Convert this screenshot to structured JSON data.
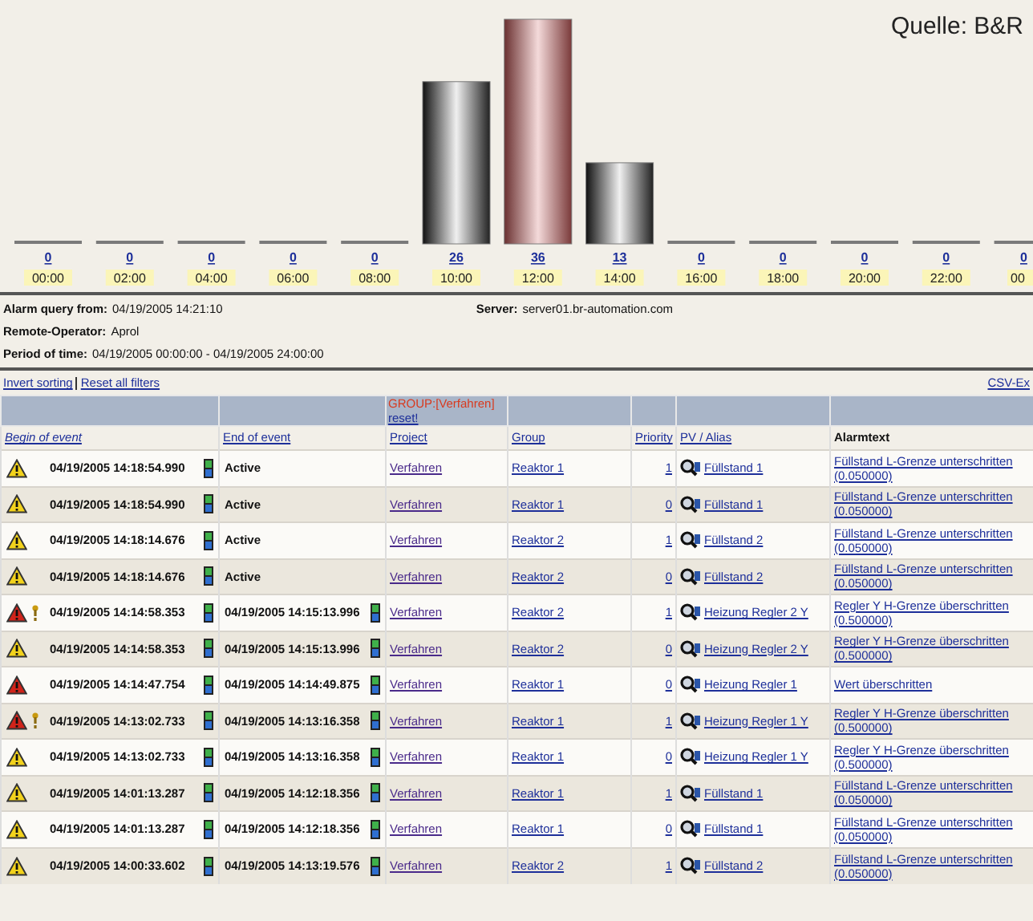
{
  "source_credit": "Quelle: B&R",
  "chart": {
    "chart_data": {
      "type": "bar",
      "categories": [
        "00:00",
        "02:00",
        "04:00",
        "06:00",
        "08:00",
        "10:00",
        "12:00",
        "14:00",
        "16:00",
        "18:00",
        "20:00",
        "22:00",
        "00"
      ],
      "series": [
        {
          "color": "#7a7a7a",
          "values": [
            0,
            0,
            0,
            0,
            0,
            26,
            36,
            13,
            0,
            0,
            0,
            0,
            0
          ]
        }
      ],
      "data_labels": true
    }
  },
  "query_info": [
    {
      "label": "Alarm query from:",
      "value": "04/19/2005 14:21:10"
    },
    {
      "label": "Remote-Operator:",
      "value": "Aprol"
    },
    {
      "label": "Period of time:",
      "value": "04/19/2005 00:00:00 - 04/19/2005 24:00:00"
    }
  ],
  "server": {
    "label": "Server:",
    "value": "server01.br-automation.com"
  },
  "links": [
    "Invert sorting",
    "Reset all filters"
  ],
  "csv_link": "CSV-Ex",
  "group_filter": {
    "text": "GROUP:[Verfahren]",
    "reset": "reset!"
  },
  "columns": [
    "Begin of event",
    "End of event",
    "Project",
    "Group",
    "Priority",
    "PV / Alias",
    "Alarmtext"
  ],
  "rows": [
    {
      "kind": "warning",
      "flag": false,
      "begin": "04/19/2005 14:18:54.990",
      "end": "Active",
      "end_active": true,
      "project": "Verfahren",
      "group": "Reaktor 1",
      "priority": "1",
      "pv": "Füllstand 1",
      "alarmtext": "Füllstand L-Grenze unterschritten (0.050000)"
    },
    {
      "kind": "warning",
      "flag": false,
      "begin": "04/19/2005 14:18:54.990",
      "end": "Active",
      "end_active": true,
      "project": "Verfahren",
      "group": "Reaktor 1",
      "priority": "0",
      "pv": "Füllstand 1",
      "alarmtext": "Füllstand L-Grenze unterschritten (0.050000)"
    },
    {
      "kind": "warning",
      "flag": false,
      "begin": "04/19/2005 14:18:14.676",
      "end": "Active",
      "end_active": true,
      "project": "Verfahren",
      "group": "Reaktor 2",
      "priority": "1",
      "pv": "Füllstand 2",
      "alarmtext": "Füllstand L-Grenze unterschritten (0.050000)"
    },
    {
      "kind": "warning",
      "flag": false,
      "begin": "04/19/2005 14:18:14.676",
      "end": "Active",
      "end_active": true,
      "project": "Verfahren",
      "group": "Reaktor 2",
      "priority": "0",
      "pv": "Füllstand 2",
      "alarmtext": "Füllstand L-Grenze unterschritten (0.050000)"
    },
    {
      "kind": "alarm",
      "flag": true,
      "begin": "04/19/2005 14:14:58.353",
      "end": "04/19/2005 14:15:13.996",
      "end_active": false,
      "project": "Verfahren",
      "group": "Reaktor 2",
      "priority": "1",
      "pv": "Heizung Regler 2 Y",
      "alarmtext": "Regler Y H-Grenze überschritten (0.500000)"
    },
    {
      "kind": "warning",
      "flag": false,
      "begin": "04/19/2005 14:14:58.353",
      "end": "04/19/2005 14:15:13.996",
      "end_active": false,
      "project": "Verfahren",
      "group": "Reaktor 2",
      "priority": "0",
      "pv": "Heizung Regler 2 Y",
      "alarmtext": "Regler Y H-Grenze überschritten (0.500000)"
    },
    {
      "kind": "alarm",
      "flag": false,
      "begin": "04/19/2005 14:14:47.754",
      "end": "04/19/2005 14:14:49.875",
      "end_active": false,
      "project": "Verfahren",
      "group": "Reaktor 1",
      "priority": "0",
      "pv": "Heizung Regler 1",
      "alarmtext": "Wert überschritten"
    },
    {
      "kind": "alarm",
      "flag": true,
      "begin": "04/19/2005 14:13:02.733",
      "end": "04/19/2005 14:13:16.358",
      "end_active": false,
      "project": "Verfahren",
      "group": "Reaktor 1",
      "priority": "1",
      "pv": "Heizung Regler 1 Y",
      "alarmtext": "Regler Y H-Grenze überschritten (0.500000)"
    },
    {
      "kind": "warning",
      "flag": false,
      "begin": "04/19/2005 14:13:02.733",
      "end": "04/19/2005 14:13:16.358",
      "end_active": false,
      "project": "Verfahren",
      "group": "Reaktor 1",
      "priority": "0",
      "pv": "Heizung Regler 1 Y",
      "alarmtext": "Regler Y H-Grenze überschritten (0.500000)"
    },
    {
      "kind": "warning",
      "flag": false,
      "begin": "04/19/2005 14:01:13.287",
      "end": "04/19/2005 14:12:18.356",
      "end_active": false,
      "project": "Verfahren",
      "group": "Reaktor 1",
      "priority": "1",
      "pv": "Füllstand 1",
      "alarmtext": "Füllstand L-Grenze unterschritten (0.050000)"
    },
    {
      "kind": "warning",
      "flag": false,
      "begin": "04/19/2005 14:01:13.287",
      "end": "04/19/2005 14:12:18.356",
      "end_active": false,
      "project": "Verfahren",
      "group": "Reaktor 1",
      "priority": "0",
      "pv": "Füllstand 1",
      "alarmtext": "Füllstand L-Grenze unterschritten (0.050000)"
    },
    {
      "kind": "warning",
      "flag": false,
      "begin": "04/19/2005 14:00:33.602",
      "end": "04/19/2005 14:13:19.576",
      "end_active": false,
      "project": "Verfahren",
      "group": "Reaktor 2",
      "priority": "1",
      "pv": "Füllstand 2",
      "alarmtext": "Füllstand L-Grenze unterschritten (0.050000)"
    }
  ]
}
